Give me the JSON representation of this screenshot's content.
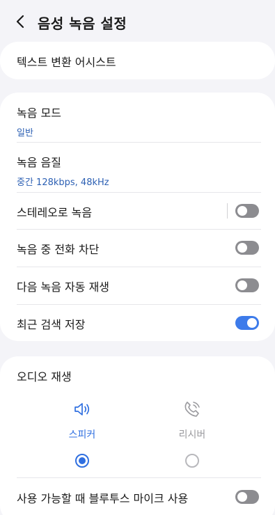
{
  "header": {
    "title": "음성 녹음 설정",
    "back_icon": "chevron-left-icon"
  },
  "assist": {
    "label": "텍스트 변환 어시스트"
  },
  "recording": {
    "mode": {
      "label": "녹음 모드",
      "value": "일반"
    },
    "quality": {
      "label": "녹음 음질",
      "value": "중간 128kbps, 48kHz"
    },
    "stereo": {
      "label": "스테레오로 녹음",
      "on": false
    },
    "block_calls": {
      "label": "녹음 중 전화 차단",
      "on": false
    },
    "autoplay_next": {
      "label": "다음 녹음 자동 재생",
      "on": false
    },
    "save_recent_search": {
      "label": "최근 검색 저장",
      "on": true
    }
  },
  "audio_playback": {
    "title": "오디오 재생",
    "options": [
      {
        "label": "스피커",
        "icon": "speaker-icon",
        "selected": true
      },
      {
        "label": "리시버",
        "icon": "phone-receiver-icon",
        "selected": false
      }
    ],
    "bluetooth_mic": {
      "label": "사용 가능할 때 블루투스 마이크 사용",
      "on": false
    }
  },
  "colors": {
    "accent": "#3d7bea",
    "sub_text": "#2b5fb3",
    "toggle_off": "#8c8c90",
    "background": "#f4f4f8"
  }
}
